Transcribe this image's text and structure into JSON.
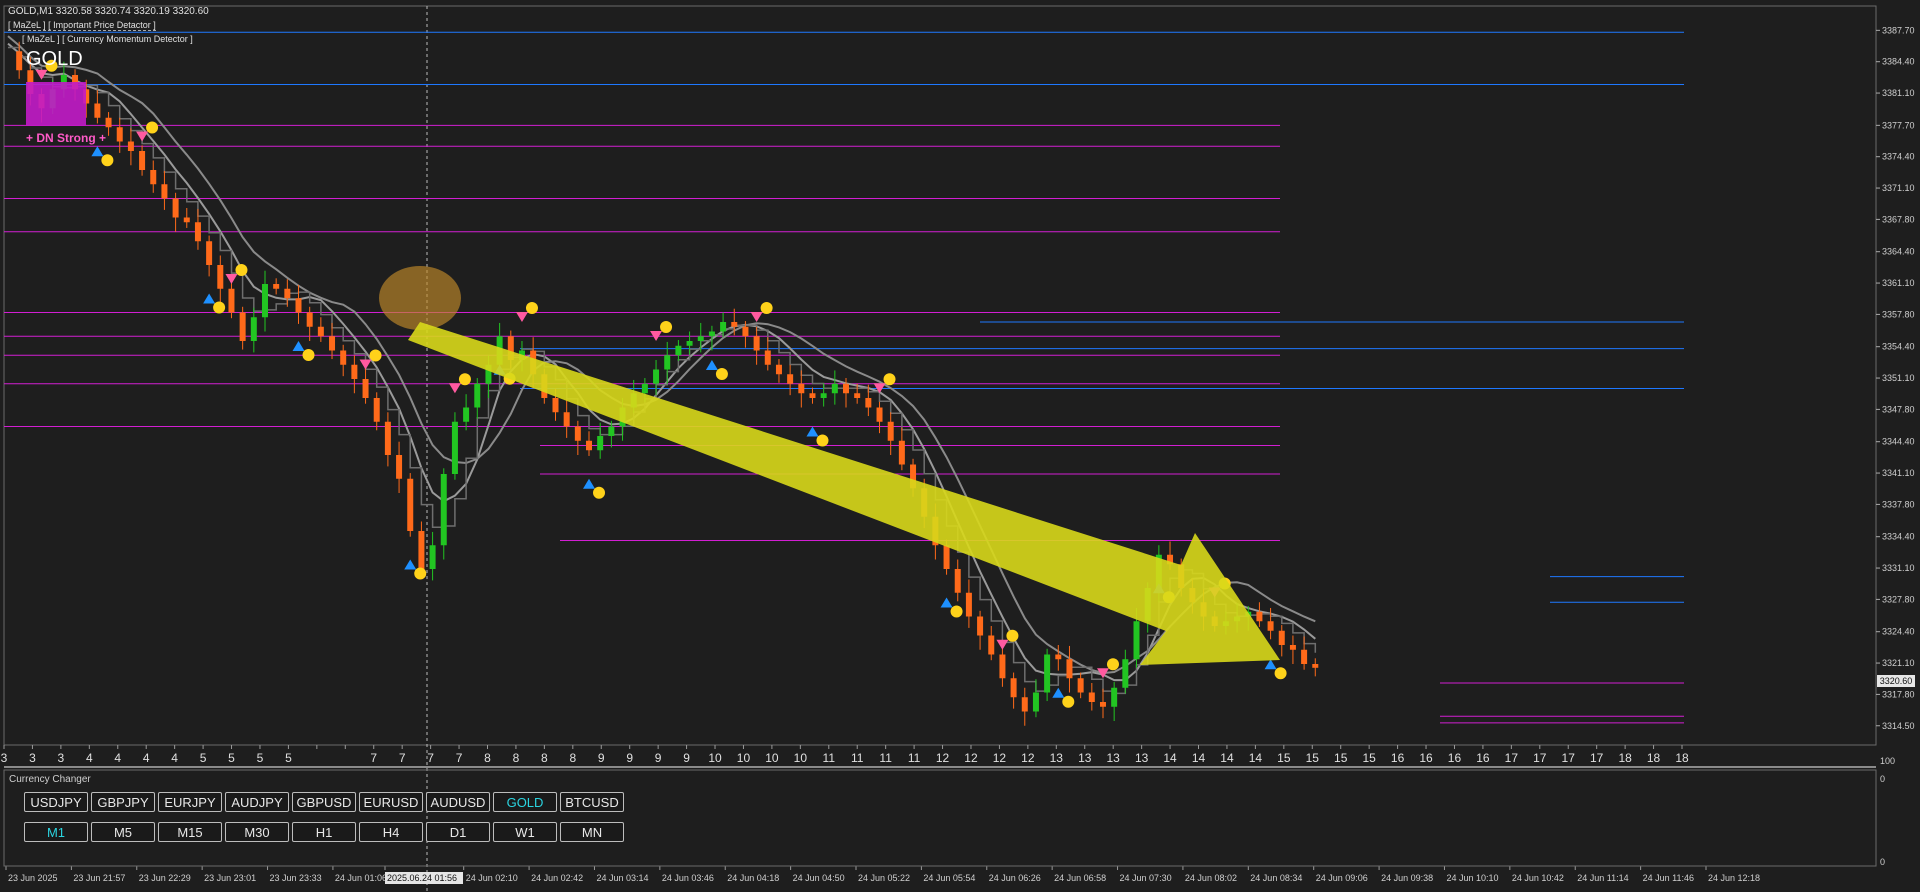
{
  "window": {
    "symbol_header": "GOLD,M1  3320.58 3320.74 3320.19 3320.60",
    "indicator_1": "[ MaZeL ] [ Important Price Detactor ]",
    "indicator_2": "[ MaZeL ] [ Currency Momentum Detector ]",
    "symbol_title": "GOLD",
    "strength_label": "+ DN Strong +",
    "current_price_tag": "3320.60"
  },
  "price_axis": [
    "3387.70",
    "3384.40",
    "3381.10",
    "3377.70",
    "3374.40",
    "3371.10",
    "3367.80",
    "3364.40",
    "3361.10",
    "3357.80",
    "3354.40",
    "3351.10",
    "3347.80",
    "3344.40",
    "3341.10",
    "3337.80",
    "3334.40",
    "3331.10",
    "3327.80",
    "3324.40",
    "3321.10",
    "3317.80",
    "3314.50"
  ],
  "hour_markers": [
    "3",
    "3",
    "3",
    "4",
    "4",
    "4",
    "4",
    "5",
    "5",
    "5",
    "5",
    "",
    "",
    "7",
    "7",
    "7",
    "7",
    "8",
    "8",
    "8",
    "8",
    "9",
    "9",
    "9",
    "9",
    "10",
    "10",
    "10",
    "10",
    "11",
    "11",
    "11",
    "11",
    "12",
    "12",
    "12",
    "12",
    "13",
    "13",
    "13",
    "13",
    "14",
    "14",
    "14",
    "14",
    "15",
    "15",
    "15",
    "15",
    "16",
    "16",
    "16",
    "16",
    "17",
    "17",
    "17",
    "17",
    "18",
    "18",
    "18"
  ],
  "time_axis": [
    "23 Jun 2025",
    "23 Jun 21:57",
    "23 Jun 22:29",
    "23 Jun 23:01",
    "23 Jun 23:33",
    "24 Jun 01:06",
    "2025.06.24 01:56",
    "24 Jun 02:10",
    "24 Jun 02:42",
    "24 Jun 03:14",
    "24 Jun 03:46",
    "24 Jun 04:18",
    "24 Jun 04:50",
    "24 Jun 05:22",
    "24 Jun 05:54",
    "24 Jun 06:26",
    "24 Jun 06:58",
    "24 Jun 07:30",
    "24 Jun 08:02",
    "24 Jun 08:34",
    "24 Jun 09:06",
    "24 Jun 09:38",
    "24 Jun 10:10",
    "24 Jun 10:42",
    "24 Jun 11:14",
    "24 Jun 11:46",
    "24 Jun 12:18"
  ],
  "sub_window": {
    "title": "Currency Changer",
    "axis": [
      "100",
      "0",
      "0"
    ],
    "symbols": [
      "USDJPY",
      "GBPJPY",
      "EURJPY",
      "AUDJPY",
      "GBPUSD",
      "EURUSD",
      "AUDUSD",
      "GOLD",
      "BTCUSD"
    ],
    "active_symbol": "GOLD",
    "timeframes": [
      "M1",
      "M5",
      "M15",
      "M30",
      "H1",
      "H4",
      "D1",
      "W1",
      "MN"
    ],
    "active_timeframe": "M1"
  },
  "colors": {
    "background": "#1e1e1e",
    "support_line": "#d21ed2",
    "resistance_line": "#1e78ff",
    "bull_candle": "#22c522",
    "bear_candle": "#ff6a1a",
    "trend_arrow": "#d8d81a",
    "active_button_text": "#2bd4e0",
    "up_arrow": "#1e90ff",
    "down_arrow": "#ff5aa0",
    "pivot_marker": "#ffd21a"
  },
  "chart_data": {
    "type": "candlestick",
    "symbol": "GOLD",
    "timeframe": "M1",
    "ylim": [
      3313.0,
      3389.0
    ],
    "x": [
      0,
      20,
      40,
      60,
      80,
      100,
      120,
      140,
      160,
      180,
      200,
      220,
      240,
      260,
      280,
      300,
      320,
      340,
      360,
      380,
      400,
      420,
      440,
      460,
      480,
      500,
      520,
      540,
      560,
      580,
      600,
      620,
      640,
      660,
      680,
      700,
      720,
      740,
      760,
      780,
      800,
      820,
      840,
      860,
      880,
      900,
      920,
      940,
      960,
      980,
      1000,
      1020,
      1040,
      1060,
      1080,
      1100,
      1120,
      1140,
      1160,
      1180,
      1200,
      1220,
      1240,
      1260,
      1280,
      1300,
      1320,
      1340,
      1360,
      1380,
      1400,
      1420,
      1440,
      1460,
      1480,
      1500,
      1520,
      1540,
      1560,
      1580,
      1600,
      1620,
      1640,
      1660,
      1680,
      1700,
      1720,
      1740,
      1760,
      1780,
      1800,
      1820,
      1840,
      1860,
      1880,
      1900,
      1920,
      1940,
      1960,
      1980,
      2000,
      2020,
      2040,
      2060,
      2080,
      2100,
      2120,
      2140,
      2160,
      2180,
      2200,
      2220,
      2240,
      2260,
      2280,
      2300,
      2320,
      2340,
      2360,
      2380,
      2400,
      2420,
      2440,
      2460,
      2480,
      2500,
      2520,
      2540,
      2560,
      2580,
      2600,
      2620,
      2640,
      2660,
      2680,
      2700,
      2720,
      2740,
      2760,
      2780,
      2800,
      2820,
      2840,
      2860,
      2880,
      2900,
      2920,
      2940,
      2960,
      2980,
      3000
    ],
    "close": [
      3385.5,
      3383.5,
      3381.0,
      3379.5,
      3381.5,
      3383.0,
      3381.5,
      3380.0,
      3378.5,
      3377.5,
      3376.0,
      3375.0,
      3373.0,
      3371.5,
      3370.0,
      3368.0,
      3367.5,
      3365.5,
      3363.0,
      3360.5,
      3358.0,
      3355.0,
      3357.5,
      3361.0,
      3360.5,
      3359.5,
      3358.0,
      3356.5,
      3355.5,
      3354.0,
      3352.5,
      3351.0,
      3349.0,
      3346.5,
      3343.0,
      3340.5,
      3335.0,
      3331.0,
      3333.5,
      3341.0,
      3346.5,
      3348.0,
      3350.5,
      3352.5,
      3355.5,
      3353.0,
      3354.0,
      3351.5,
      3349.0,
      3347.5,
      3346.0,
      3344.5,
      3343.5,
      3345.0,
      3346.0,
      3348.0,
      3349.5,
      3350.5,
      3352.0,
      3353.5,
      3354.5,
      3355.0,
      3355.5,
      3356.0,
      3357.0,
      3356.5,
      3355.5,
      3354.0,
      3352.5,
      3351.5,
      3350.5,
      3349.5,
      3349.0,
      3349.5,
      3350.5,
      3349.5,
      3349.0,
      3348.0,
      3346.5,
      3344.5,
      3342.0,
      3339.5,
      3336.5,
      3333.5,
      3331.0,
      3328.5,
      3326.0,
      3324.0,
      3322.0,
      3319.5,
      3317.5,
      3316.0,
      3318.0,
      3322.0,
      3321.5,
      3319.5,
      3318.0,
      3317.0,
      3316.5,
      3318.5,
      3321.5,
      3325.5,
      3329.0,
      3332.5,
      3331.5,
      3329.0,
      3327.5,
      3326.0,
      3325.0,
      3325.5,
      3326.0,
      3326.5,
      3325.5,
      3324.5,
      3323.0,
      3322.5,
      3321.0,
      3320.6
    ],
    "levels_support": [
      3377.7,
      3375.5,
      3370.0,
      3366.5,
      3358.0,
      3355.5,
      3353.5,
      3350.5,
      3346.0,
      3344.0,
      3341.0,
      3334.0,
      3319.0,
      3315.5,
      3314.8
    ],
    "levels_resistance": [
      3387.5,
      3382.0,
      3357.0,
      3354.2,
      3350.0,
      3330.2,
      3327.5
    ],
    "current_price": 3320.6,
    "annotations": [
      "+ DN Strong +"
    ]
  }
}
